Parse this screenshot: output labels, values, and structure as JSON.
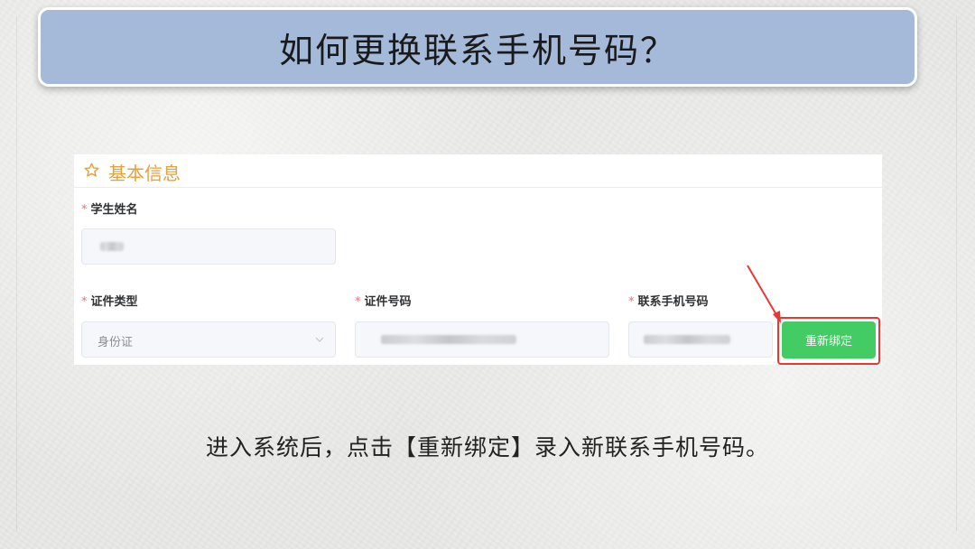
{
  "header": {
    "title": "如何更换联系手机号码？"
  },
  "form": {
    "section_title": "基本信息",
    "icon": "star-outline-icon",
    "fields": {
      "student_name": {
        "label": "学生姓名",
        "required_mark": "*"
      },
      "id_type": {
        "label": "证件类型",
        "required_mark": "*",
        "value": "身份证"
      },
      "id_number": {
        "label": "证件号码",
        "required_mark": "*"
      },
      "phone": {
        "label": "联系手机号码",
        "required_mark": "*"
      }
    },
    "rebind_button_label": "重新绑定"
  },
  "instruction": {
    "text": "进入系统后，点击【重新绑定】录入新联系手机号码。"
  },
  "colors": {
    "banner": "#a5bad9",
    "accent": "#e2a23a",
    "required": "#f56c6c",
    "button": "#43cc64",
    "highlight": "#e53935"
  }
}
